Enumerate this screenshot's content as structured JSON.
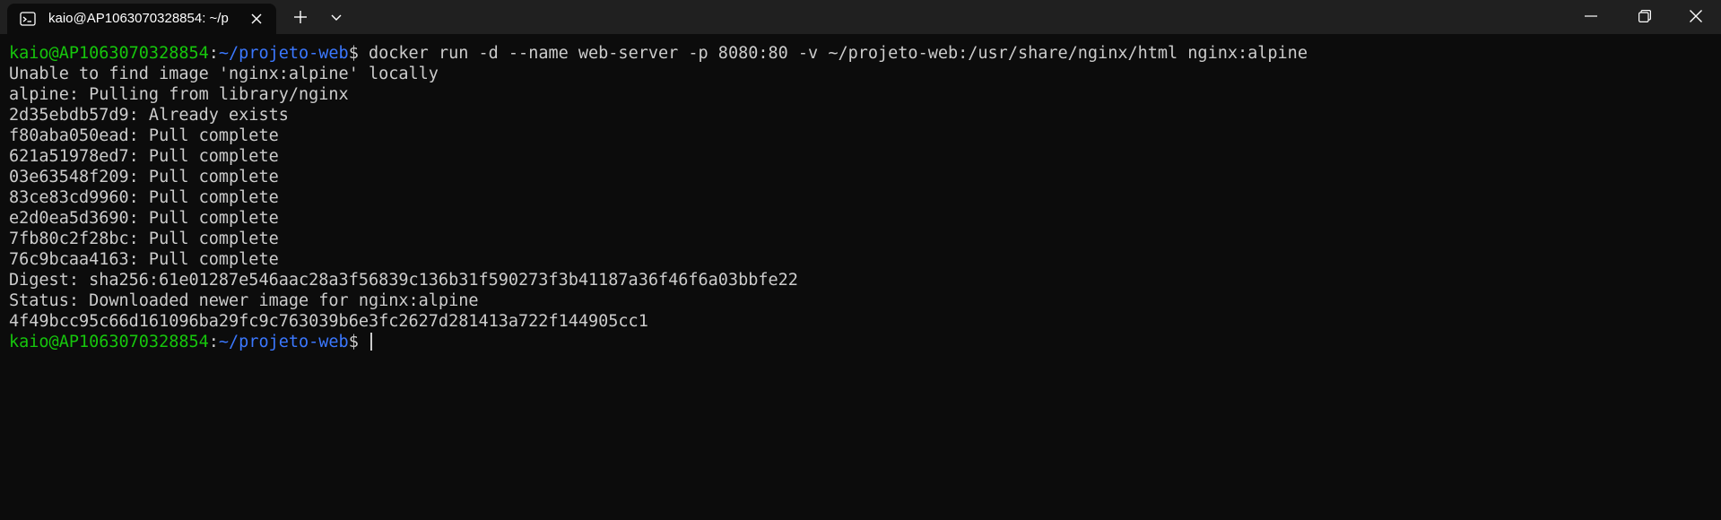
{
  "window": {
    "tab_title": "kaio@AP1063070328854: ~/p",
    "icons": {
      "tab": "terminal-icon",
      "close_tab": "close-icon",
      "new_tab": "plus-icon",
      "dropdown": "chevron-down-icon",
      "minimize": "minimize-icon",
      "maximize": "restore-icon",
      "close": "close-icon"
    }
  },
  "colors": {
    "background": "#0c0c0c",
    "titlebar": "#202020",
    "text": "#cccccc",
    "prompt_user": "#16c60c",
    "prompt_path": "#3b78ff"
  },
  "terminal": {
    "prompt_user": "kaio@AP1063070328854",
    "prompt_sep": ":",
    "prompt_path": "~/projeto-web",
    "prompt_symbol": "$ ",
    "command": "docker run -d --name web-server -p 8080:80 -v ~/projeto-web:/usr/share/nginx/html nginx:alpine",
    "output": [
      "Unable to find image 'nginx:alpine' locally",
      "alpine: Pulling from library/nginx",
      "2d35ebdb57d9: Already exists",
      "f80aba050ead: Pull complete",
      "621a51978ed7: Pull complete",
      "03e63548f209: Pull complete",
      "83ce83cd9960: Pull complete",
      "e2d0ea5d3690: Pull complete",
      "7fb80c2f28bc: Pull complete",
      "76c9bcaa4163: Pull complete",
      "Digest: sha256:61e01287e546aac28a3f56839c136b31f590273f3b41187a36f46f6a03bbfe22",
      "Status: Downloaded newer image for nginx:alpine",
      "4f49bcc95c66d161096ba29fc9c763039b6e3fc2627d281413a722f144905cc1"
    ]
  }
}
